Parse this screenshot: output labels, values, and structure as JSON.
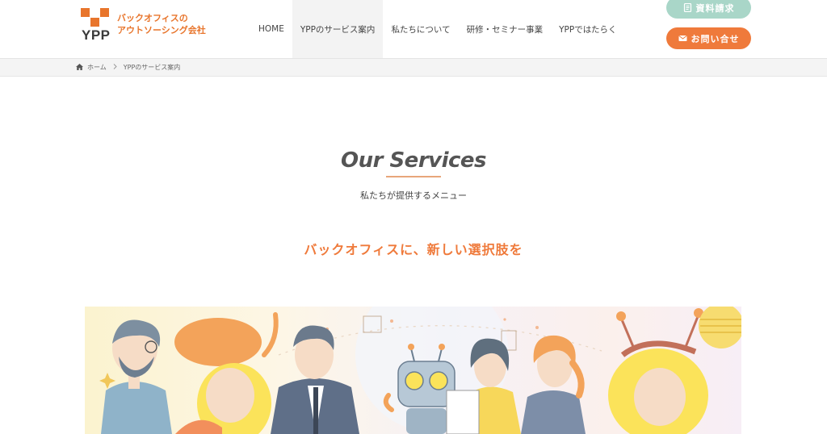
{
  "logo": {
    "mark_text": "YPP",
    "tagline_line1": "バックオフィスの",
    "tagline_line2": "アウトソーシング会社",
    "color": "#e8752c"
  },
  "nav": {
    "items": [
      {
        "label": "HOME",
        "active": false
      },
      {
        "label": "YPPのサービス案内",
        "active": true
      },
      {
        "label": "私たちについて",
        "active": false
      },
      {
        "label": "研修・セミナー事業",
        "active": false
      },
      {
        "label": "YPPではたらく",
        "active": false
      }
    ]
  },
  "header_buttons": {
    "document_request": {
      "label": "資料請求",
      "icon": "document-icon",
      "color": "#a9d6c8"
    },
    "contact": {
      "label": "お問い合せ",
      "icon": "mail-icon",
      "color": "#ef7a3b"
    }
  },
  "breadcrumb": {
    "home_label": "ホーム",
    "home_icon": "home-icon",
    "separator_icon": "chevron-right-icon",
    "current_label": "YPPのサービス案内"
  },
  "main": {
    "title": "Our Services",
    "subtitle": "私たちが提供するメニュー",
    "catch_copy": "バックオフィスに、新しい選択肢を",
    "accent_color": "#ef7a3b"
  },
  "hero": {
    "illustration": "group-of-people-and-robot-illustration"
  }
}
